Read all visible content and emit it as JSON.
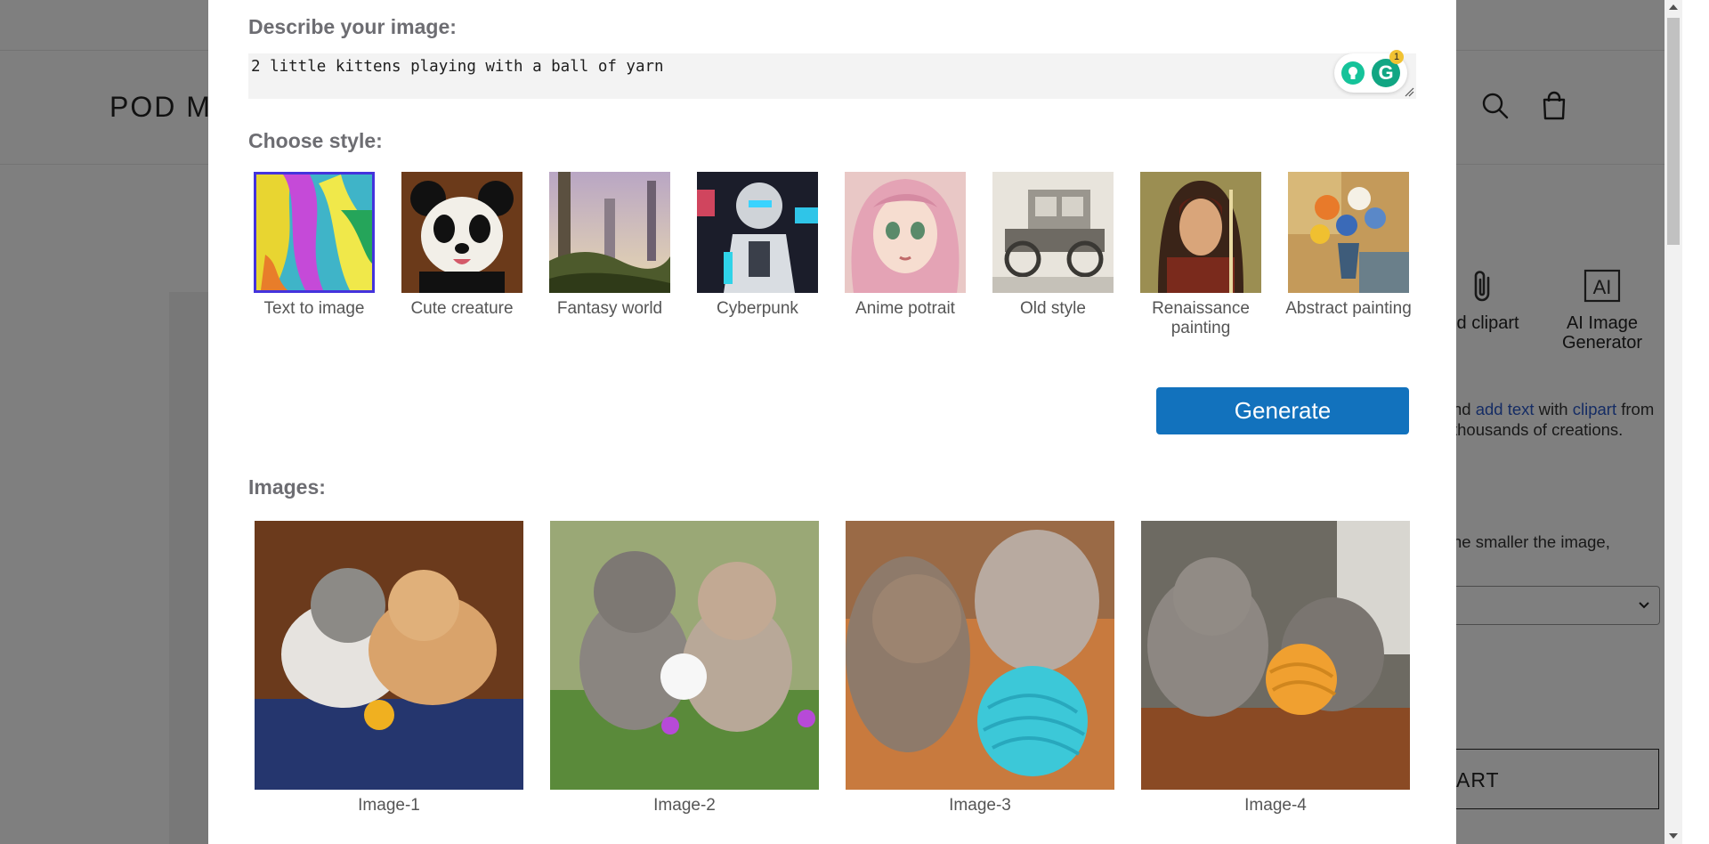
{
  "background_page": {
    "logo": "POD Ma",
    "tools": [
      {
        "label": "dd clipart",
        "icon": "paperclip-icon"
      },
      {
        "label": "AI Image Generator",
        "icon": "ai-icon",
        "icon_text": "AI"
      }
    ],
    "description": {
      "part1": "nd ",
      "link1": "add text",
      "part2": " with ",
      "link2": "clipart",
      "part3": " from thousands of creations."
    },
    "size_note": "he smaller the image,",
    "cart_button": "ART"
  },
  "modal": {
    "describe_label": "Describe your image:",
    "prompt_value": "2 little kittens playing with a ball of yarn",
    "grammarly_badge": "1",
    "grammarly_letter": "G",
    "style_label": "Choose style:",
    "styles": [
      {
        "name": "Text to image",
        "selected": true
      },
      {
        "name": "Cute creature",
        "selected": false
      },
      {
        "name": "Fantasy world",
        "selected": false
      },
      {
        "name": "Cyberpunk",
        "selected": false
      },
      {
        "name": "Anime potrait",
        "selected": false
      },
      {
        "name": "Old style",
        "selected": false
      },
      {
        "name": "Renaissance painting",
        "selected": false
      },
      {
        "name": "Abstract painting",
        "selected": false
      }
    ],
    "generate_label": "Generate",
    "images_label": "Images:",
    "images": [
      {
        "caption": "Image-1"
      },
      {
        "caption": "Image-2"
      },
      {
        "caption": "Image-3"
      },
      {
        "caption": "Image-4"
      }
    ]
  },
  "colors": {
    "accent": "#1272bd",
    "selected_border": "#4433dd",
    "label": "#6d6d72",
    "link": "#2a59c8",
    "grammarly": "#15c39a"
  }
}
